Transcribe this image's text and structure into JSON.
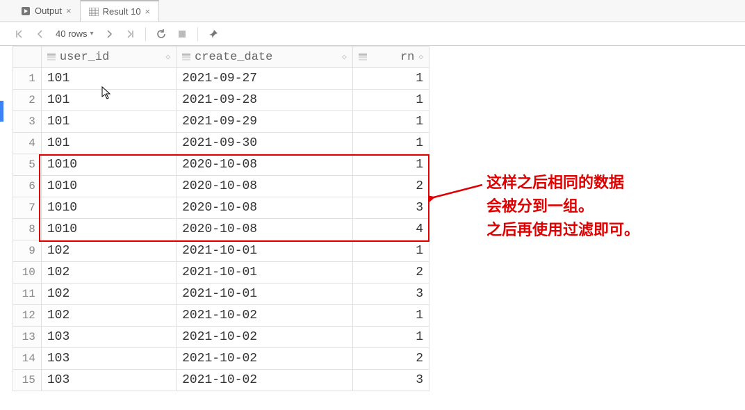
{
  "tabs": [
    {
      "label": "Output",
      "icon": "play"
    },
    {
      "label": "Result 10",
      "icon": "table"
    }
  ],
  "toolbar": {
    "rows_label": "40 rows"
  },
  "columns": [
    {
      "name": "user_id"
    },
    {
      "name": "create_date"
    },
    {
      "name": "rn"
    }
  ],
  "rows": [
    {
      "n": 1,
      "user_id": "101",
      "create_date": "2021-09-27",
      "rn": 1
    },
    {
      "n": 2,
      "user_id": "101",
      "create_date": "2021-09-28",
      "rn": 1
    },
    {
      "n": 3,
      "user_id": "101",
      "create_date": "2021-09-29",
      "rn": 1
    },
    {
      "n": 4,
      "user_id": "101",
      "create_date": "2021-09-30",
      "rn": 1
    },
    {
      "n": 5,
      "user_id": "1010",
      "create_date": "2020-10-08",
      "rn": 1
    },
    {
      "n": 6,
      "user_id": "1010",
      "create_date": "2020-10-08",
      "rn": 2
    },
    {
      "n": 7,
      "user_id": "1010",
      "create_date": "2020-10-08",
      "rn": 3
    },
    {
      "n": 8,
      "user_id": "1010",
      "create_date": "2020-10-08",
      "rn": 4
    },
    {
      "n": 9,
      "user_id": "102",
      "create_date": "2021-10-01",
      "rn": 1
    },
    {
      "n": 10,
      "user_id": "102",
      "create_date": "2021-10-01",
      "rn": 2
    },
    {
      "n": 11,
      "user_id": "102",
      "create_date": "2021-10-01",
      "rn": 3
    },
    {
      "n": 12,
      "user_id": "102",
      "create_date": "2021-10-02",
      "rn": 1
    },
    {
      "n": 13,
      "user_id": "103",
      "create_date": "2021-10-02",
      "rn": 1
    },
    {
      "n": 14,
      "user_id": "103",
      "create_date": "2021-10-02",
      "rn": 2
    },
    {
      "n": 15,
      "user_id": "103",
      "create_date": "2021-10-02",
      "rn": 3
    }
  ],
  "annotation": {
    "line1": "这样之后相同的数据",
    "line2": "会被分到一组。",
    "line3": "之后再使用过滤即可。"
  }
}
